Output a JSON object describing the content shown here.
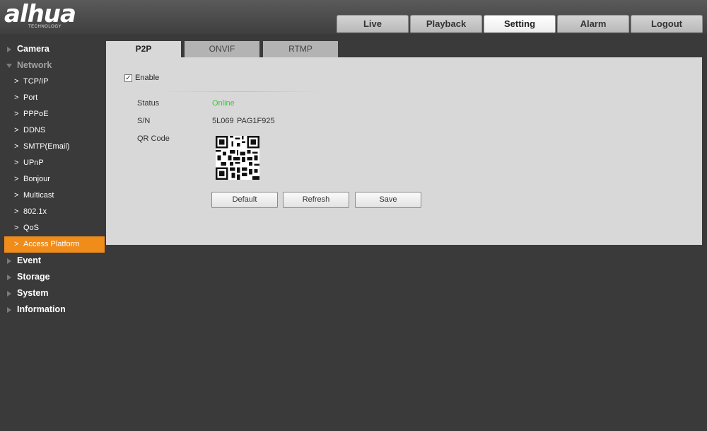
{
  "header": {
    "logo_text": "alhua",
    "logo_sub": "TECHNOLOGY",
    "tabs": [
      {
        "label": "Live"
      },
      {
        "label": "Playback"
      },
      {
        "label": "Setting"
      },
      {
        "label": "Alarm"
      },
      {
        "label": "Logout"
      }
    ],
    "active_tab": "Setting"
  },
  "sidebar": {
    "groups": [
      {
        "label": "Camera"
      },
      {
        "label": "Network",
        "items": [
          {
            "label": "TCP/IP"
          },
          {
            "label": "Port"
          },
          {
            "label": "PPPoE"
          },
          {
            "label": "DDNS"
          },
          {
            "label": "SMTP(Email)"
          },
          {
            "label": "UPnP"
          },
          {
            "label": "Bonjour"
          },
          {
            "label": "Multicast"
          },
          {
            "label": "802.1x"
          },
          {
            "label": "QoS"
          },
          {
            "label": "Access Platform"
          }
        ]
      },
      {
        "label": "Event"
      },
      {
        "label": "Storage"
      },
      {
        "label": "System"
      },
      {
        "label": "Information"
      }
    ],
    "active_item": "Access Platform"
  },
  "content": {
    "tabs": [
      {
        "label": "P2P"
      },
      {
        "label": "ONVIF"
      },
      {
        "label": "RTMP"
      }
    ],
    "active_tab": "P2P",
    "enable_label": "Enable",
    "enable_checked": true,
    "status_label": "Status",
    "status_value": "Online",
    "sn_label": "S/N",
    "sn_value": "5L069  PAG1F925",
    "qr_label": "QR Code",
    "buttons": {
      "default": "Default",
      "refresh": "Refresh",
      "save": "Save"
    }
  },
  "colors": {
    "accent": "#f08c1a",
    "online": "#33cc33",
    "panel": "#d8d8d8",
    "background": "#3a3a3a"
  }
}
